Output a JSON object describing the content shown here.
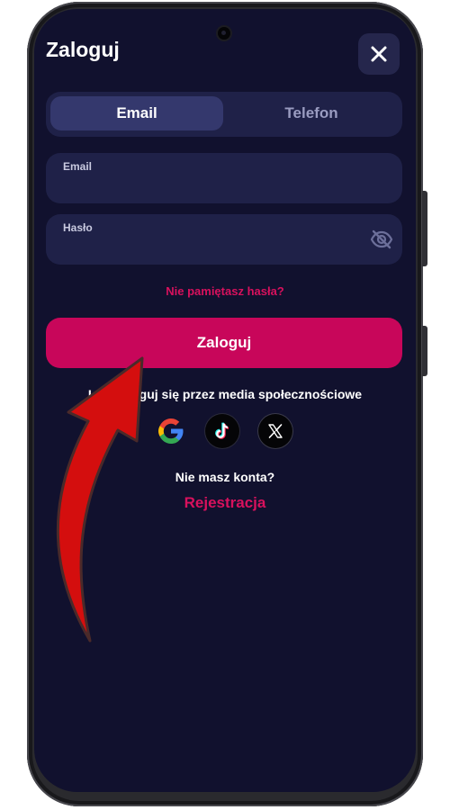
{
  "header": {
    "title": "Zaloguj",
    "close_icon": "close-icon"
  },
  "tabs": [
    {
      "label": "Email",
      "active": true
    },
    {
      "label": "Telefon",
      "active": false
    }
  ],
  "form": {
    "email_label": "Email",
    "email_value": "",
    "password_label": "Hasło",
    "password_value": "",
    "password_toggle_icon": "eye-off-icon",
    "forgot_password": "Nie pamiętasz hasła?",
    "submit_label": "Zaloguj"
  },
  "social": {
    "caption": "Lub zaloguj się przez media społecznościowe",
    "providers": [
      {
        "name": "Google",
        "icon": "google-icon"
      },
      {
        "name": "TikTok",
        "icon": "tiktok-icon"
      },
      {
        "name": "X",
        "icon": "x-icon"
      }
    ]
  },
  "footer": {
    "no_account": "Nie masz konta?",
    "register_label": "Rejestracja"
  },
  "colors": {
    "background": "#11112e",
    "surface": "#1f2148",
    "tab_active": "#34386d",
    "accent": "#c8065a",
    "accent_text": "#d8115d",
    "annotation_arrow": "#d40e0e"
  }
}
